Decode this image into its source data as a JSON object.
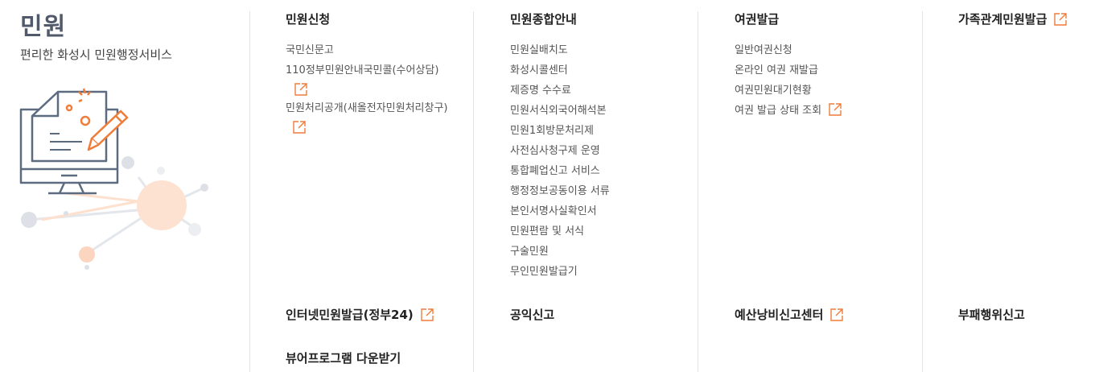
{
  "section": {
    "title": "민원",
    "subtitle": "편리한 화성시 민원행정서비스"
  },
  "columns": [
    {
      "title": "민원신청",
      "items": [
        {
          "label": "국민신문고",
          "external": false
        },
        {
          "label": "110정부민원안내국민콜(수어상담)",
          "external": true
        },
        {
          "label": "민원처리공개(새올전자민원처리창구)",
          "external": true
        }
      ]
    },
    {
      "title": "민원종합안내",
      "items": [
        {
          "label": "민원실배치도",
          "external": false
        },
        {
          "label": "화성시콜센터",
          "external": false
        },
        {
          "label": "제증명 수수료",
          "external": false
        },
        {
          "label": "민원서식외국어해석본",
          "external": false
        },
        {
          "label": "민원1회방문처리제",
          "external": false
        },
        {
          "label": "사전심사청구제 운영",
          "external": false
        },
        {
          "label": "통합폐업신고 서비스",
          "external": false
        },
        {
          "label": "행정정보공동이용 서류",
          "external": false
        },
        {
          "label": "본인서명사실확인서",
          "external": false
        },
        {
          "label": "민원편람 및 서식",
          "external": false
        },
        {
          "label": "구술민원",
          "external": false
        },
        {
          "label": "무인민원발급기",
          "external": false
        }
      ]
    },
    {
      "title": "여권발급",
      "items": [
        {
          "label": "일반여권신청",
          "external": false
        },
        {
          "label": "온라인 여권 재발급",
          "external": false
        },
        {
          "label": "여권민원대기현황",
          "external": false
        },
        {
          "label": "여권 발급 상태 조회",
          "external": true
        }
      ]
    },
    {
      "title": "가족관계민원발급",
      "external": true,
      "items": []
    }
  ],
  "bottom_row": [
    {
      "label": "인터넷민원발급(정부24)",
      "external": true
    },
    {
      "label": "공익신고",
      "external": false
    },
    {
      "label": "예산낭비신고센터",
      "external": true
    },
    {
      "label": "부패행위신고",
      "external": false
    }
  ],
  "bottom_row2": [
    {
      "label": "뷰어프로그램 다운받기",
      "external": false
    }
  ],
  "colors": {
    "accent_orange": "#f07c3a",
    "icon_slate": "#5d6b80",
    "divider": "#e4e4e4"
  },
  "icons": {
    "external_link": "external-link-icon",
    "illustration": "monitor-document-pencil-illustration"
  }
}
